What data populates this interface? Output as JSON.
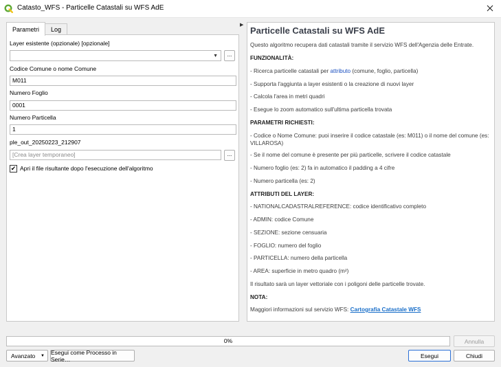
{
  "window": {
    "title": "Catasto_WFS - Particelle Catastali su WFS AdE"
  },
  "tabs": [
    {
      "label": "Parametri"
    },
    {
      "label": "Log"
    }
  ],
  "form": {
    "layer_label": "Layer esistente (opzionale) [opzionale]",
    "layer_value": "",
    "comune_label": "Codice Comune o nome Comune",
    "comune_value": "M011",
    "foglio_label": "Numero Foglio",
    "foglio_value": "0001",
    "particella_label": "Numero Particella",
    "particella_value": "1",
    "output_label": "ple_out_20250223_212907",
    "output_placeholder": "[Crea layer temporaneo]",
    "open_file_label": "Apri il file risultante dopo l'esecuzione dell'algoritmo",
    "open_file_checked": true,
    "browse_label": "..."
  },
  "help": {
    "title": "Particelle Catastali su WFS AdE",
    "intro": "Questo algoritmo recupera dati catastali tramite il servizio WFS dell'Agenzia delle Entrate.",
    "funz_heading": "FUNZIONALITÀ:",
    "funz_1_pre": "- Ricerca particelle catastali per ",
    "funz_1_link": "attributo",
    "funz_1_post": " (comune, foglio, particella)",
    "funz_2": "- Supporta l'aggiunta a layer esistenti o la creazione di nuovi layer",
    "funz_3": "- Calcola l'area in metri quadri",
    "funz_4": "- Esegue lo zoom automatico sull'ultima particella trovata",
    "param_heading": "PARAMETRI RICHIESTI:",
    "param_1": "- Codice o Nome Comune: puoi inserire il codice catastale (es: M011) o il nome del comune (es: VILLAROSA)",
    "param_2": "- Se il nome del comune è presente per più particelle, scrivere il codice catastale",
    "param_3": "- Numero foglio (es: 2) fa in automatico il padding a 4 cifre",
    "param_4": "- Numero particella (es: 2)",
    "attr_heading": "ATTRIBUTI DEL LAYER:",
    "attr_1": "- NATIONALCADASTRALREFERENCE: codice identificativo completo",
    "attr_2": "- ADMIN: codice Comune",
    "attr_3": "- SEZIONE: sezione censuaria",
    "attr_4": "- FOGLIO: numero del foglio",
    "attr_5": "- PARTICELLA: numero della particella",
    "attr_6": "- AREA: superficie in metro quadro (m²)",
    "result": "Il risultato sarà un layer vettoriale con i poligoni delle particelle trovate.",
    "nota_heading": "NOTA:",
    "nota_pre": "Maggiori informazioni sul servizio WFS: ",
    "nota_link": "Cartografia Catastale WFS"
  },
  "footer": {
    "progress_text": "0%",
    "progress_value": 0,
    "cancel_label": "Annulla",
    "advanced_label": "Avanzato",
    "batch_label": "Esegui come Processo in Serie…",
    "run_label": "Esegui",
    "close_label": "Chiudi"
  },
  "colors": {
    "accent": "#2a6fd6",
    "link": "#1a4fbf",
    "qgis_green": "#5ea935"
  }
}
